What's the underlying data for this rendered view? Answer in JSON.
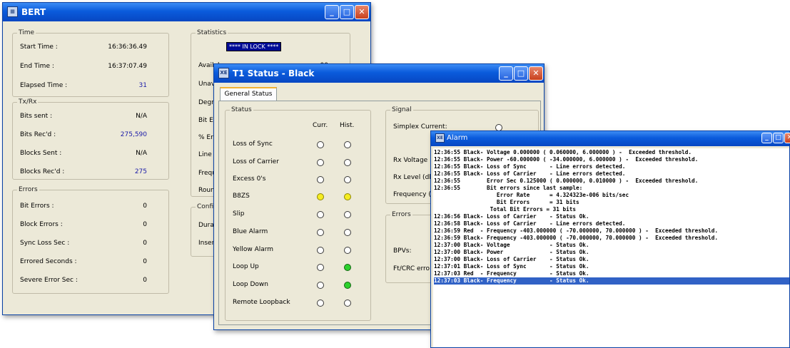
{
  "bert": {
    "title": "BERT",
    "time": {
      "legend": "Time",
      "rows": [
        {
          "label": "Start Time :",
          "value": "16:36:36.49"
        },
        {
          "label": "End Time :",
          "value": "16:37:07.49"
        },
        {
          "label": "Elapsed Time :",
          "value": "31"
        }
      ]
    },
    "txrx": {
      "legend": "Tx/Rx",
      "rows": [
        {
          "label": "Bits sent :",
          "value": "N/A"
        },
        {
          "label": "Bits Rec'd :",
          "value": "275,590"
        },
        {
          "label": "Blocks Sent :",
          "value": "N/A"
        },
        {
          "label": "Blocks Rec'd :",
          "value": "275"
        }
      ]
    },
    "errors": {
      "legend": "Errors",
      "rows": [
        {
          "label": "Bit Errors :",
          "value": "0"
        },
        {
          "label": "Block Errors :",
          "value": "0"
        },
        {
          "label": "Sync Loss Sec :",
          "value": "0"
        },
        {
          "label": "Errored Seconds :",
          "value": "0"
        },
        {
          "label": "Severe Error Sec :",
          "value": "0"
        }
      ]
    },
    "statistics": {
      "legend": "Statistics",
      "in_lock": "**** IN LOCK ****",
      "rows": [
        "Availab",
        "Unav",
        "Degr",
        "Bit Er",
        "% Er",
        "Line",
        "Frequ",
        "Roun"
      ],
      "partial_value": "00"
    },
    "config": {
      "legend": "Confi",
      "rows": [
        "Durat",
        "Inser"
      ]
    }
  },
  "t1": {
    "title": "T1 Status - Black",
    "tab": "General Status",
    "status": {
      "legend": "Status",
      "col_curr": "Curr.",
      "col_hist": "Hist.",
      "rows": [
        {
          "label": "Loss of Sync",
          "curr": "off",
          "hist": "off"
        },
        {
          "label": "Loss of Carrier",
          "curr": "off",
          "hist": "off"
        },
        {
          "label": "Excess 0's",
          "curr": "off",
          "hist": "off"
        },
        {
          "label": "B8ZS",
          "curr": "yellow",
          "hist": "yellow"
        },
        {
          "label": "Slip",
          "curr": "off",
          "hist": "off"
        },
        {
          "label": "Blue Alarm",
          "curr": "off",
          "hist": "off"
        },
        {
          "label": "Yellow Alarm",
          "curr": "off",
          "hist": "off"
        },
        {
          "label": "Loop Up",
          "curr": "off",
          "hist": "green"
        },
        {
          "label": "Loop Down",
          "curr": "off",
          "hist": "green"
        },
        {
          "label": "Remote Loopback",
          "curr": "off",
          "hist": "off"
        }
      ]
    },
    "signal": {
      "legend": "Signal",
      "simplex_current": "Simplex Current:",
      "rx_voltage": "Rx Voltage",
      "rx_level": "Rx Level (dl",
      "frequency": "Frequency ("
    },
    "errors": {
      "legend": "Errors",
      "bpvs": "BPVs:",
      "ftcrc": "Ft/CRC erro"
    }
  },
  "alarm": {
    "title": "Alarm",
    "lines": [
      "12:36:55 Black- Voltage 0.000000 ( 0.060000, 6.000000 ) -  Exceeded threshold.",
      "12:36:55 Black- Power -60.000000 ( -34.000000, 6.000000 ) -  Exceeded threshold.",
      "12:36:55 Black- Loss of Sync       - Line errors detected.",
      "12:36:55 Black- Loss of Carrier    - Line errors detected.",
      "12:36:55        Error Sec 0.125000 ( 0.000000, 0.010000 ) -  Exceeded threshold.",
      "12:36:55        Bit errors since last sample:",
      "                   Error Rate      = 4.324323e-006 bits/sec",
      "                   Bit Errors      = 31 bits",
      "                 Total Bit Errors = 31 bits",
      "12:36:56 Black- Loss of Carrier    - Status Ok.",
      "12:36:58 Black- Loss of Carrier    - Line errors detected.",
      "12:36:59 Red  - Frequency -403.000000 ( -70.000000, 70.000000 ) -  Exceeded threshold.",
      "12:36:59 Black- Frequency -403.000000 ( -70.000000, 70.000000 ) -  Exceeded threshold.",
      "12:37:00 Black- Voltage            - Status Ok.",
      "12:37:00 Black- Power              - Status Ok.",
      "12:37:00 Black- Loss of Carrier    - Status Ok.",
      "12:37:01 Black- Loss of Sync       - Status Ok.",
      "12:37:03 Red  - Frequency          - Status Ok.",
      "12:37:03 Black- Frequency          - Status Ok."
    ]
  }
}
